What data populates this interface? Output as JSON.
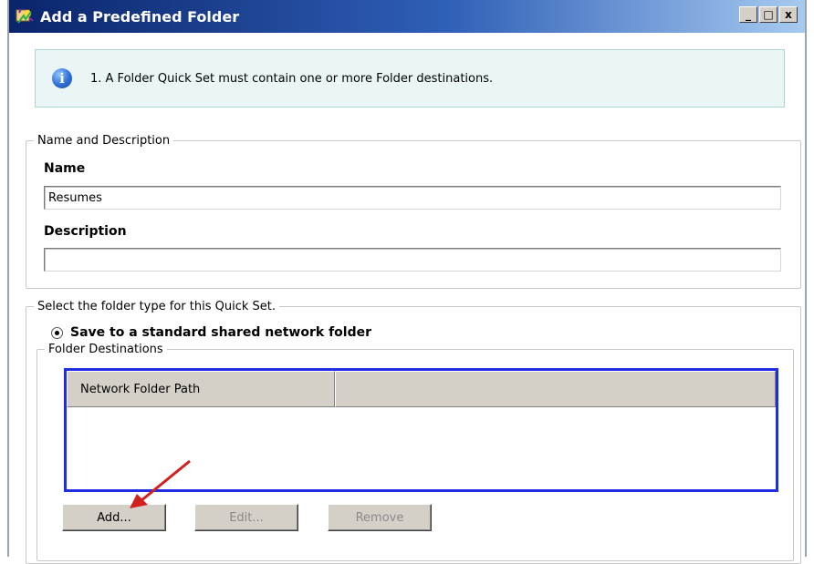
{
  "window": {
    "title": "Add a Predefined Folder",
    "controls": {
      "minimize": "_",
      "maximize": "□",
      "close": "x"
    }
  },
  "info": {
    "icon": "info-icon",
    "glyph": "i",
    "message": "1.  A Folder Quick Set must contain one or more Folder destinations."
  },
  "name_group": {
    "legend": "Name and Description",
    "name_label": "Name",
    "name_value": "Resumes",
    "description_label": "Description",
    "description_value": ""
  },
  "folder_type_group": {
    "legend": "Select the folder type for this Quick Set.",
    "radio_label": "Save to a standard shared network folder",
    "radio_selected": true,
    "destinations": {
      "legend": "Folder Destinations",
      "columns": [
        "Network Folder Path",
        ""
      ],
      "rows": []
    },
    "buttons": {
      "add": "Add...",
      "edit": "Edit...",
      "remove": "Remove"
    }
  },
  "colors": {
    "titlebar_start": "#0a246a",
    "info_background": "#eaf6f6",
    "list_border": "#1f2ee0",
    "annotation_arrow": "#d0201f"
  }
}
